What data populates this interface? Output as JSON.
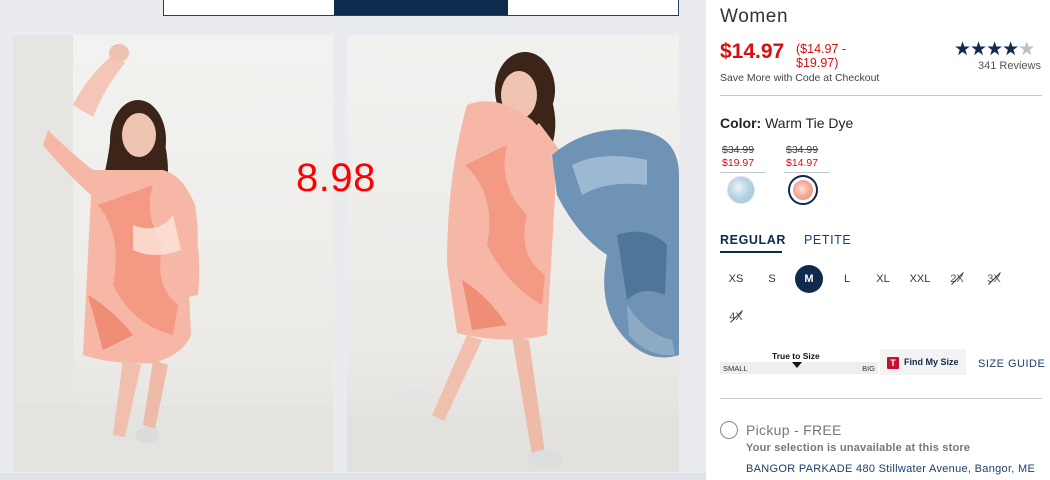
{
  "gallery": {
    "overlay_price": "8.98"
  },
  "product": {
    "category": "Women",
    "price": "$14.97",
    "price_range": "($14.97 - $19.97)",
    "promo_text": "Save More with Code at Checkout",
    "rating": 4.5,
    "rating_max": 5,
    "reviews": "341 Reviews"
  },
  "color": {
    "label": "Color:",
    "selected_value": "Warm Tie Dye",
    "swatches": [
      {
        "was": "$34.99",
        "now": "$19.97",
        "name": "blue-tie-dye",
        "hex": "#b9d4e2"
      },
      {
        "was": "$34.99",
        "now": "$14.97",
        "name": "warm-tie-dye",
        "hex": "#f6a795",
        "selected": true
      }
    ]
  },
  "fit_tabs": [
    {
      "label": "REGULAR",
      "active": true
    },
    {
      "label": "PETITE",
      "active": false
    }
  ],
  "sizes": [
    {
      "label": "XS",
      "state": "available"
    },
    {
      "label": "S",
      "state": "available"
    },
    {
      "label": "M",
      "state": "selected"
    },
    {
      "label": "L",
      "state": "available"
    },
    {
      "label": "XL",
      "state": "available"
    },
    {
      "label": "XXL",
      "state": "available"
    },
    {
      "label": "2X",
      "state": "unavailable"
    },
    {
      "label": "3X",
      "state": "unavailable"
    },
    {
      "label": "4X",
      "state": "unavailable"
    }
  ],
  "fit_meter": {
    "title": "True to Size",
    "min_label": "SMALL",
    "max_label": "BIG"
  },
  "find_my_size": {
    "logo_letter": "T",
    "label": "Find My Size"
  },
  "size_guide": "SIZE GUIDE",
  "pickup": {
    "label": "Pickup - FREE",
    "message": "Your selection is unavailable at this store",
    "store": "BANGOR PARKADE 480 Stillwater Avenue, Bangor, ME"
  },
  "colors": {
    "brand_navy": "#0e2a4d",
    "sale_red": "#d50f0f"
  }
}
